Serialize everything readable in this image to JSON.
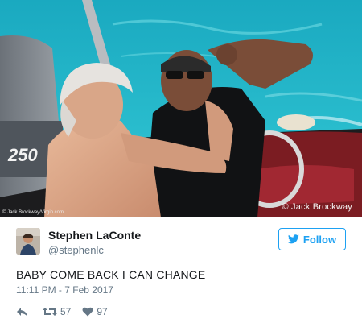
{
  "photo": {
    "credit_small": "© Jack Brockway/Virgin.com",
    "credit_large": "© Jack Brockway",
    "engine_label": "250"
  },
  "user": {
    "display_name": "Stephen LaConte",
    "handle": "@stephenlc"
  },
  "follow_button": {
    "label": "Follow",
    "icon": "twitter-bird-icon"
  },
  "tweet": {
    "text": "BABY COME BACK I CAN CHANGE",
    "timestamp": "11:11 PM - 7 Feb 2017"
  },
  "actions": {
    "reply_icon": "reply-icon",
    "retweet_icon": "retweet-icon",
    "retweet_count": "57",
    "like_icon": "heart-icon",
    "like_count": "97"
  },
  "colors": {
    "accent": "#1da1f2",
    "text": "#14171a",
    "muted": "#657786",
    "water": "#1fb6c6"
  }
}
